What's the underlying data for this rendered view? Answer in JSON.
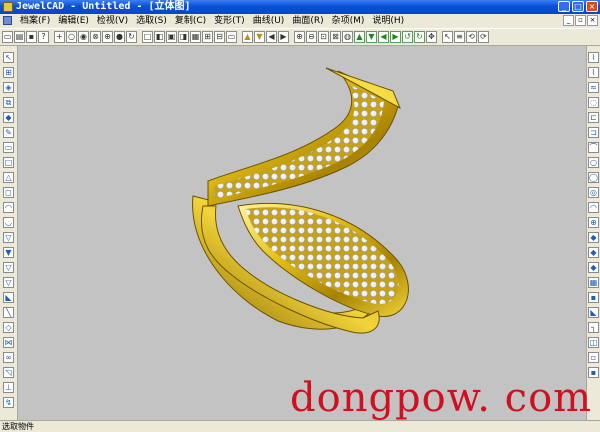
{
  "window": {
    "title": "JewelCAD - Untitled - [立体图]"
  },
  "menu": {
    "items": [
      {
        "label": "档案(F)"
      },
      {
        "label": "编辑(E)"
      },
      {
        "label": "检视(V)"
      },
      {
        "label": "选取(S)"
      },
      {
        "label": "复制(C)"
      },
      {
        "label": "变形(T)"
      },
      {
        "label": "曲线(U)"
      },
      {
        "label": "曲面(R)"
      },
      {
        "label": "杂项(M)"
      },
      {
        "label": "说明(H)"
      }
    ]
  },
  "toolbar": {
    "icons": [
      "new-file-icon",
      "open-file-icon",
      "save-icon",
      "help-pointer-icon",
      "pan-cross-icon",
      "circle-icon",
      "dot-circle-icon",
      "cross-circle-icon",
      "target-icon",
      "filled-circle-icon",
      "rotate-circle-icon",
      "square-icon",
      "half-square-icon",
      "box-icon",
      "box-fill-icon",
      "box-split-icon",
      "grid-icon",
      "grid-4-icon",
      "wide-box-icon",
      "triangle-up-icon",
      "triangle-down-icon",
      "play-left-icon",
      "play-right-icon",
      "zoom-in-icon",
      "zoom-out-icon",
      "zoom-window-icon",
      "zoom-all-icon",
      "render-icon",
      "arrow-up-green-icon",
      "arrow-down-green-icon",
      "arrow-left-green-icon",
      "arrow-right-green-icon",
      "rotate-ccw-icon",
      "rotate-cw-icon",
      "move-all-icon",
      "cursor-icon",
      "layers-icon",
      "undo-icon",
      "redo-icon"
    ]
  },
  "status": {
    "text": "选取物件"
  },
  "watermark": {
    "text": "dongpow. com"
  },
  "colors": {
    "gold": "#e6c31a",
    "viewport": "#c3c3c3",
    "watermark": "#d10f1f",
    "title_bar": "#0a4fd8"
  }
}
